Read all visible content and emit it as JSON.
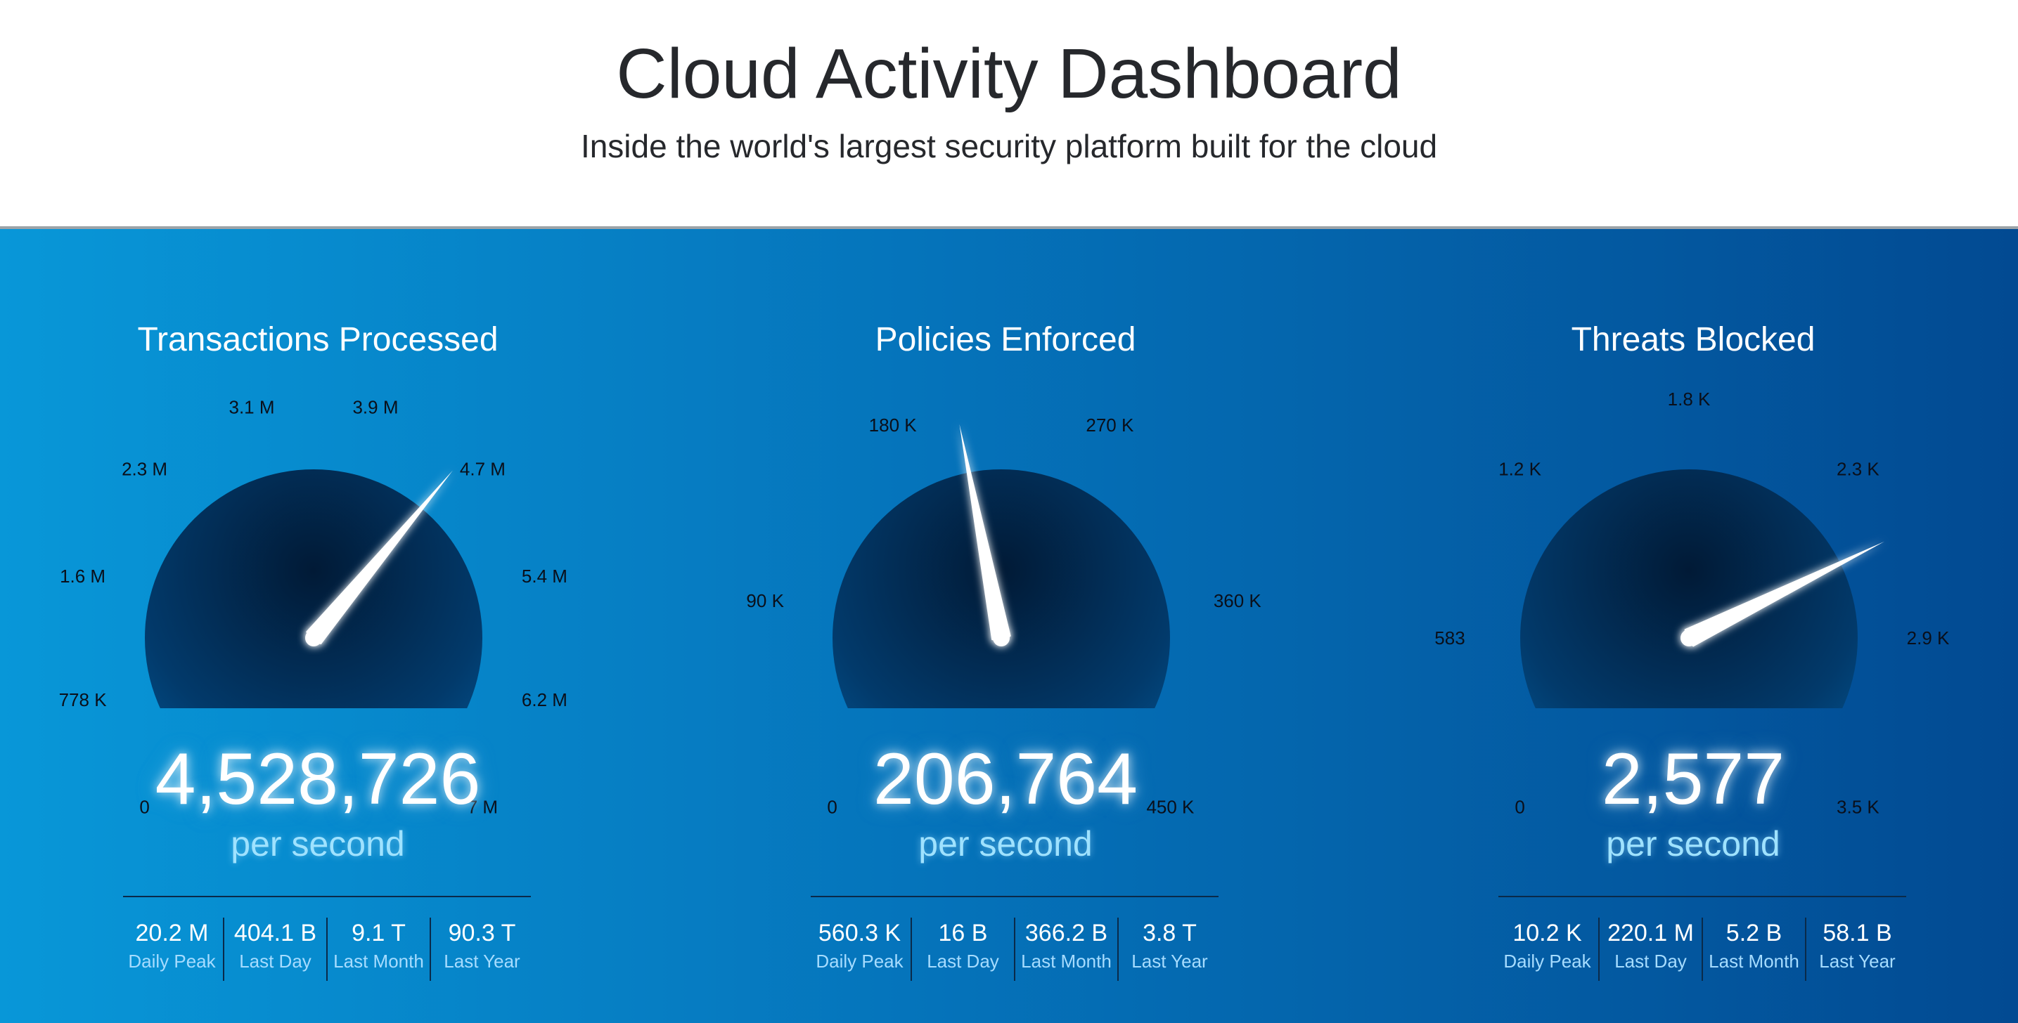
{
  "header": {
    "title": "Cloud Activity Dashboard",
    "subtitle": "Inside the world's largest security platform built for the cloud"
  },
  "colors": {
    "panel_left": "#0897d8",
    "panel_right": "#024a92",
    "needle": "#ffffff",
    "unit_text": "#9fe2ff"
  },
  "gauges": [
    {
      "title": "Transactions Processed",
      "value": "4,528,726",
      "unit": "per second",
      "tick_labels": [
        "0",
        "778 K",
        "1.6 M",
        "2.3 M",
        "3.1 M",
        "3.9 M",
        "4.7 M",
        "5.4 M",
        "6.2 M",
        "7 M"
      ],
      "needle_fraction": 0.647,
      "stats": [
        {
          "value": "20.2 M",
          "label": "Daily Peak"
        },
        {
          "value": "404.1 B",
          "label": "Last Day"
        },
        {
          "value": "9.1 T",
          "label": "Last Month"
        },
        {
          "value": "90.3 T",
          "label": "Last Year"
        }
      ]
    },
    {
      "title": "Policies Enforced",
      "value": "206,764",
      "unit": "per second",
      "tick_labels": [
        "0",
        "90 K",
        "180 K",
        "270 K",
        "360 K",
        "450 K"
      ],
      "needle_fraction": 0.459,
      "stats": [
        {
          "value": "560.3 K",
          "label": "Daily Peak"
        },
        {
          "value": "16 B",
          "label": "Last Day"
        },
        {
          "value": "366.2 B",
          "label": "Last Month"
        },
        {
          "value": "3.8 T",
          "label": "Last Year"
        }
      ]
    },
    {
      "title": "Threats Blocked",
      "value": "2,577",
      "unit": "per second",
      "tick_labels": [
        "0",
        "583",
        "1.2 K",
        "1.8 K",
        "2.3 K",
        "2.9 K",
        "3.5 K"
      ],
      "needle_fraction": 0.736,
      "stats": [
        {
          "value": "10.2 K",
          "label": "Daily Peak"
        },
        {
          "value": "220.1 M",
          "label": "Last Day"
        },
        {
          "value": "5.2 B",
          "label": "Last Month"
        },
        {
          "value": "58.1 B",
          "label": "Last Year"
        }
      ]
    }
  ]
}
